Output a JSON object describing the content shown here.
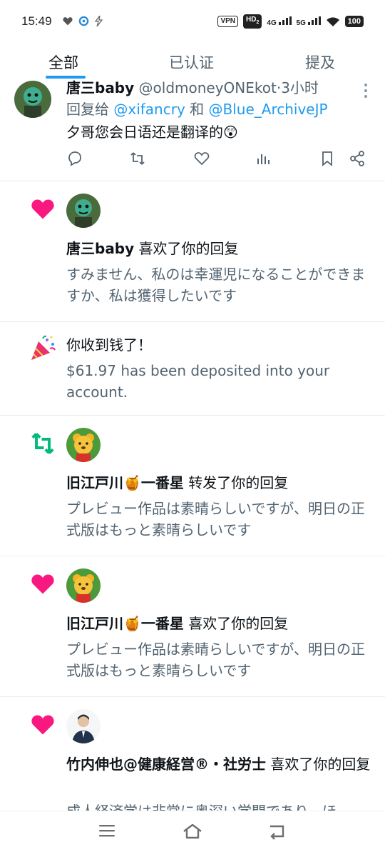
{
  "status": {
    "time": "15:49",
    "vpn": "VPN",
    "hd": "HD",
    "hd_sub": "2",
    "net1": "4G",
    "net2": "5G",
    "battery": "100"
  },
  "tabs": [
    {
      "label": "全部",
      "active": true
    },
    {
      "label": "已认证",
      "active": false
    },
    {
      "label": "提及",
      "active": false
    }
  ],
  "tweet": {
    "name": "唐三baby",
    "handle": "@oldmoneyONEkot",
    "time": "3小时",
    "reply_prefix": "回复给",
    "reply_to_1": "@xifancry",
    "reply_and": "和",
    "reply_to_2": "@Blue_ArchiveJP",
    "text": "夕哥您会日语还是翻译的😲"
  },
  "notifications": [
    {
      "type": "like",
      "name": "唐三baby",
      "action": "喜欢了你的回复",
      "text": "すみません、私のは幸運児になることができますか、私は獲得したいです"
    },
    {
      "type": "money",
      "title": "你收到钱了！",
      "text": "$61.97 has been deposited into your account."
    },
    {
      "type": "retweet",
      "name": "旧江戸川🍯一番星",
      "action": "转发了你的回复",
      "text": "プレビュー作品は素晴らしいですが、明日の正式版はもっと素晴らしいです"
    },
    {
      "type": "like",
      "name": "旧江戸川🍯一番星",
      "action": "喜欢了你的回复",
      "text": "プレビュー作品は素晴らしいですが、明日の正式版はもっと素晴らしいです"
    },
    {
      "type": "like",
      "name": "竹内伸也@健康経営®・社労士",
      "action": "喜欢了你的回复",
      "text": "成人経済学は非常に奥深い学問であり、ほ"
    }
  ],
  "colors": {
    "like": "#f91880",
    "retweet": "#00ba7c",
    "link": "#1d9bf0",
    "muted": "#536471"
  }
}
